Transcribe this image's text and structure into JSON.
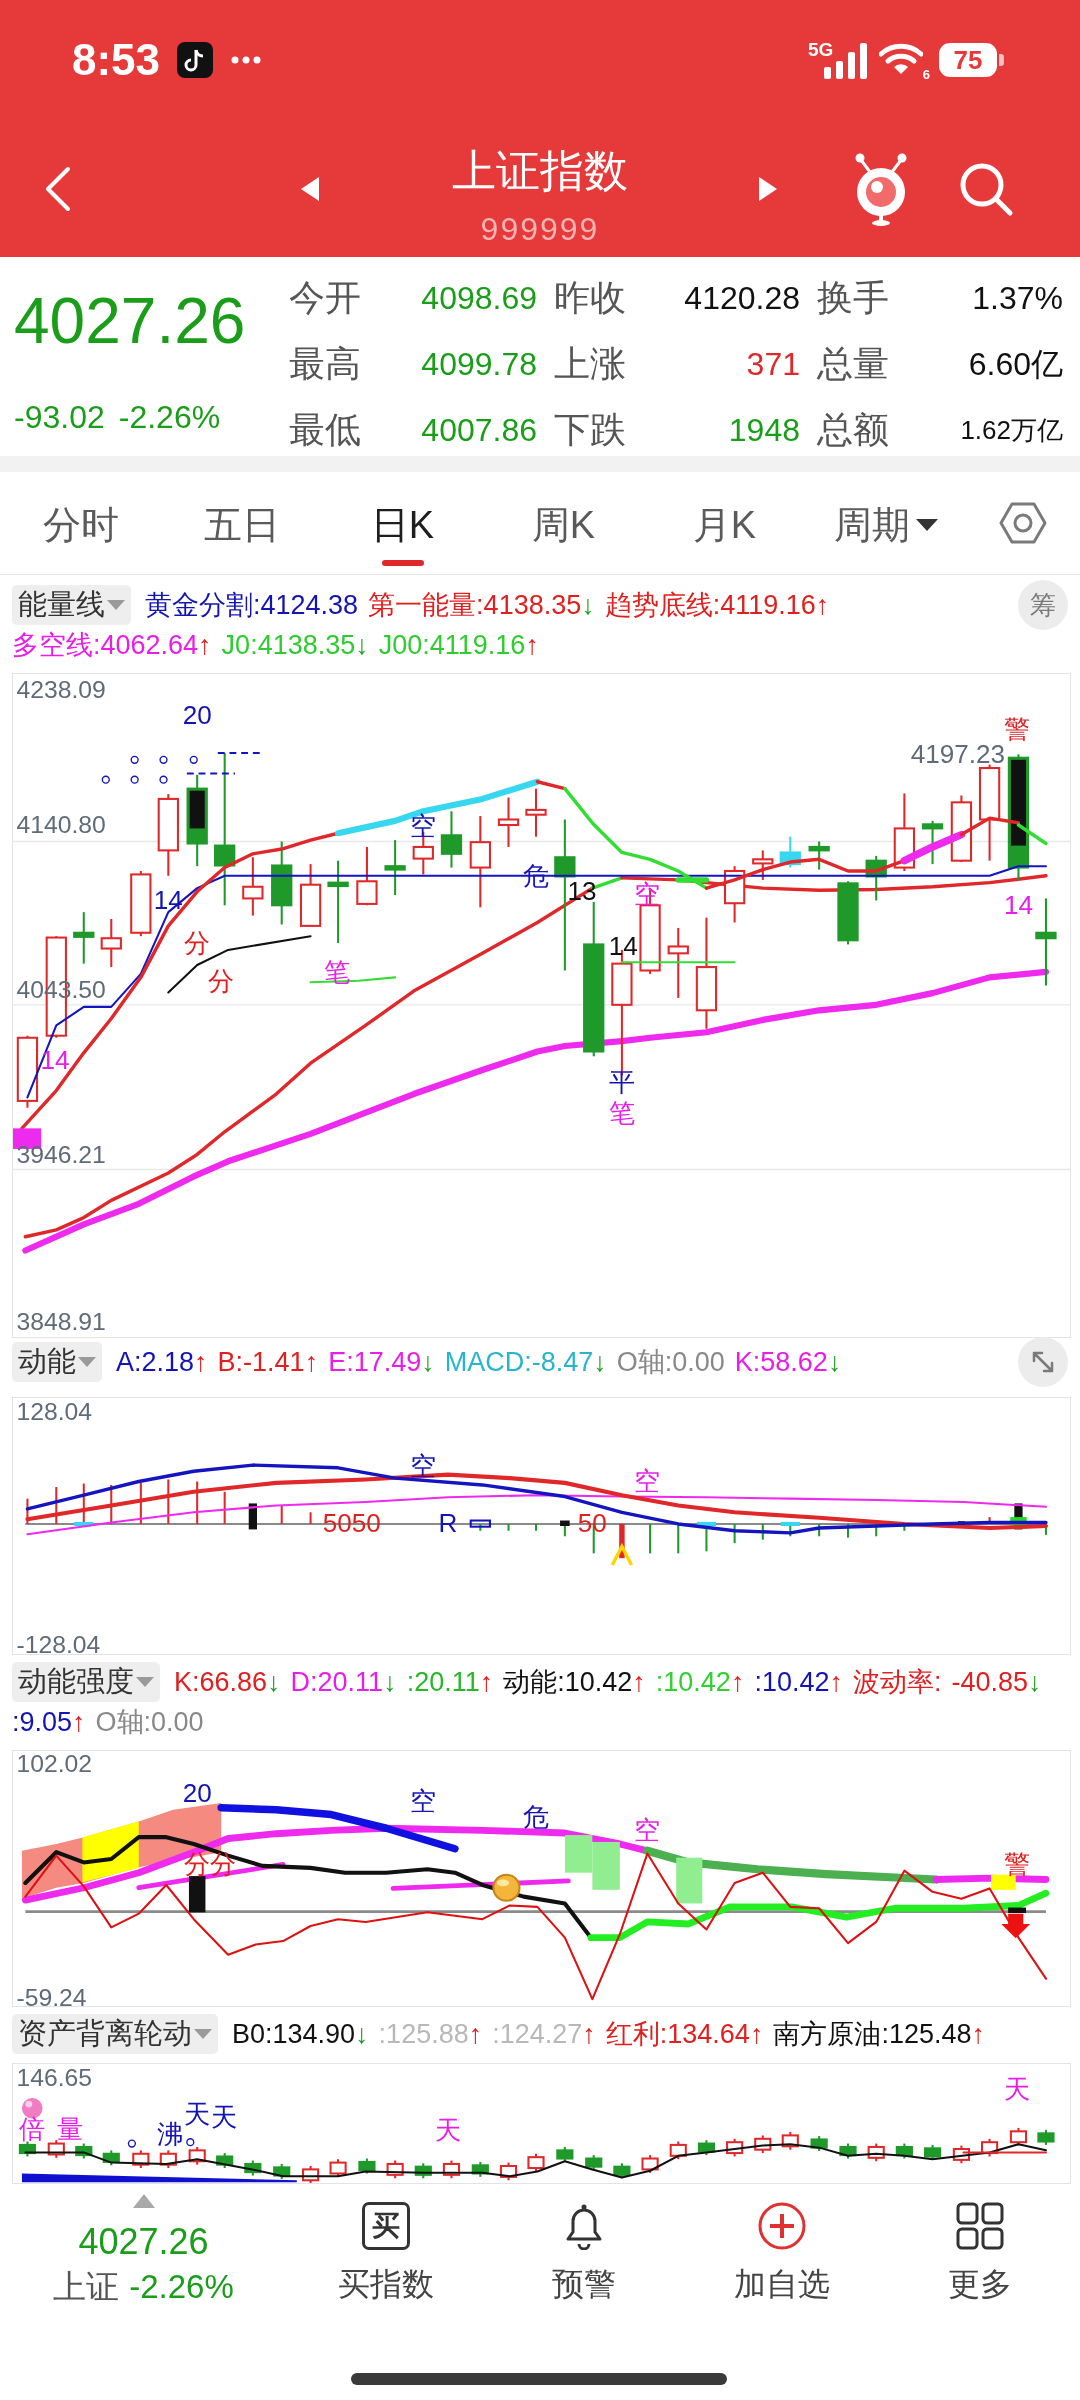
{
  "status_bar": {
    "time": "8:53",
    "network": "5G",
    "wifi_badge": "6",
    "battery": "75"
  },
  "header": {
    "title": "上证指数",
    "code": "999999"
  },
  "quote": {
    "price": "4027.26",
    "change": "-93.02",
    "change_percent": "-2.26%",
    "fields": [
      {
        "label": "今开",
        "value": "4098.69",
        "color": "#1a9e1a",
        "kind": "normal"
      },
      {
        "label": "昨收",
        "value": "4120.28",
        "color": "#111111",
        "kind": "normal"
      },
      {
        "label": "换手",
        "value": "1.37%",
        "color": "#111111",
        "kind": "normal"
      },
      {
        "label": "最高",
        "value": "4099.78",
        "color": "#1a9e1a",
        "kind": "normal"
      },
      {
        "label": "上涨",
        "value": "371",
        "color": "#e0282a",
        "kind": "normal"
      },
      {
        "label": "总量",
        "value": "6.60亿",
        "color": "#111111",
        "kind": "normal"
      },
      {
        "label": "最低",
        "value": "4007.86",
        "color": "#1a9e1a",
        "kind": "normal"
      },
      {
        "label": "下跌",
        "value": "1948",
        "color": "#1a9e1a",
        "kind": "normal"
      },
      {
        "label": "总额",
        "value": "1.62万亿",
        "color": "#111111",
        "kind": "compact"
      }
    ]
  },
  "tabs": [
    {
      "label": "分时",
      "selected": false,
      "kind": "tab"
    },
    {
      "label": "五日",
      "selected": false,
      "kind": "tab"
    },
    {
      "label": "日K",
      "selected": true,
      "kind": "tab"
    },
    {
      "label": "周K",
      "selected": false,
      "kind": "tab"
    },
    {
      "label": "月K",
      "selected": false,
      "kind": "tab"
    },
    {
      "label": "周期",
      "selected": false,
      "kind": "dropdown"
    }
  ],
  "panels": [
    {
      "kind": "energy",
      "indicator": "能量线",
      "side_button": "筹",
      "legend": [
        {
          "text": "黄金分割:4124.38",
          "color": "#1414b4"
        },
        {
          "text": "第一能量:4138.35",
          "color": "#e0201f",
          "arrow": {
            "text": "↓",
            "color": "#22a022"
          }
        },
        {
          "text": "趋势底线:4119.16",
          "color": "#e0201f",
          "arrow": {
            "text": "↑",
            "color": "#e0201f"
          }
        },
        {
          "text": "多空线:4062.64",
          "color": "#e81ee8",
          "arrow": {
            "text": "↑",
            "color": "#e0201f"
          }
        },
        {
          "text": "J0:4138.35",
          "color": "#2ecc2e",
          "arrow": {
            "text": "↓",
            "color": "#22a022"
          }
        },
        {
          "text": "J00:4119.16",
          "color": "#2ecc2e",
          "arrow": {
            "text": "↑",
            "color": "#e0201f"
          }
        }
      ],
      "y_axis_labels": [
        "4238.09",
        "4140.80",
        "4043.50",
        "3946.21",
        "3848.91"
      ],
      "annotations": [
        {
          "text": "20",
          "color": "#1414b4"
        },
        {
          "text": "14",
          "color": "#1414b4"
        },
        {
          "text": "14",
          "color": "#e81ee8"
        },
        {
          "text": "分",
          "color": "#e0201f"
        },
        {
          "text": "分",
          "color": "#e0201f"
        },
        {
          "text": "笔",
          "color": "#e81ee8"
        },
        {
          "text": "空",
          "color": "#1414b4"
        },
        {
          "text": "危",
          "color": "#1414b4"
        },
        {
          "text": "13",
          "color": "#111111"
        },
        {
          "text": "14",
          "color": "#111111"
        },
        {
          "text": "空",
          "color": "#e81ee8"
        },
        {
          "text": "平",
          "color": "#1414b4"
        },
        {
          "text": "笔",
          "color": "#e81ee8"
        },
        {
          "text": "4197.23",
          "color": "#5f6b78"
        },
        {
          "text": "警",
          "color": "#d8262a"
        },
        {
          "text": "14",
          "color": "#e81ee8"
        }
      ]
    },
    {
      "kind": "macd",
      "indicator": "动能",
      "legend": [
        {
          "text": "A:2.18",
          "color": "#1414b4",
          "arrow": {
            "text": "↑",
            "color": "#e0201f"
          }
        },
        {
          "text": "B:-1.41",
          "color": "#e0201f",
          "arrow": {
            "text": "↑",
            "color": "#e0201f"
          }
        },
        {
          "text": "E:17.49",
          "color": "#e81ee8",
          "arrow": {
            "text": "↓",
            "color": "#22a022"
          }
        },
        {
          "text": "MACD:-8.47",
          "color": "#26b5cc",
          "arrow": {
            "text": "↓",
            "color": "#22a022"
          }
        },
        {
          "text": "O轴:0.00",
          "color": "#888888"
        },
        {
          "text": "K:58.62",
          "color": "#e81ee8",
          "arrow": {
            "text": "↓",
            "color": "#22a022"
          }
        }
      ],
      "y_axis_labels": [
        "128.04",
        "-128.04"
      ],
      "annotations": [
        {
          "text": "空",
          "color": "#1414b4"
        },
        {
          "text": "空",
          "color": "#e81ee8"
        },
        {
          "text": "5050",
          "color": "#e0201f"
        },
        {
          "text": "R",
          "color": "#1414b4"
        },
        {
          "text": "50",
          "color": "#e0201f"
        }
      ]
    },
    {
      "kind": "strength",
      "indicator": "动能强度",
      "legend": [
        {
          "text": "K:66.86",
          "color": "#e0201f",
          "arrow": {
            "text": "↓",
            "color": "#22a022"
          }
        },
        {
          "text": "D:20.11",
          "color": "#e81ee8",
          "arrow": {
            "text": "↓",
            "color": "#22a022"
          }
        },
        {
          "text": ":20.11",
          "color": "#27b827",
          "arrow": {
            "text": "↑",
            "color": "#e0201f"
          }
        },
        {
          "text": "动能:10.42",
          "color": "#111111",
          "arrow": {
            "text": "↑",
            "color": "#e0201f"
          }
        },
        {
          "text": ":10.42",
          "color": "#2ed12e",
          "arrow": {
            "text": "↑",
            "color": "#e0201f"
          }
        },
        {
          "text": ":10.42",
          "color": "#1414b4",
          "arrow": {
            "text": "↑",
            "color": "#e0201f"
          }
        },
        {
          "text": "波动率:",
          "color": "#e0201f"
        },
        {
          "text": "-40.85",
          "color": "#e0201f",
          "arrow": {
            "text": "↓",
            "color": "#22a022"
          }
        },
        {
          "text": ":9.05",
          "color": "#1414b4",
          "arrow": {
            "text": "↑",
            "color": "#e0201f"
          }
        },
        {
          "text": "O轴:0.00",
          "color": "#888888"
        }
      ],
      "y_axis_labels": [
        "102.02",
        "-59.24"
      ],
      "annotations": [
        {
          "text": "20",
          "color": "#1414b4"
        },
        {
          "text": "空",
          "color": "#1414b4"
        },
        {
          "text": "危",
          "color": "#1414b4"
        },
        {
          "text": "空",
          "color": "#e81ee8"
        },
        {
          "text": "分",
          "color": "#e0201f"
        },
        {
          "text": "分",
          "color": "#e0201f"
        },
        {
          "text": "警",
          "color": "#e0201f"
        }
      ]
    },
    {
      "kind": "rotation",
      "indicator": "资产背离轮动",
      "legend": [
        {
          "text": "B0:134.90",
          "color": "#111111",
          "arrow": {
            "text": "↓",
            "color": "#22a022"
          }
        },
        {
          "text": ":125.88",
          "color": "#b8b8b8",
          "arrow": {
            "text": "↑",
            "color": "#e0201f"
          }
        },
        {
          "text": ":124.27",
          "color": "#b8b8b8",
          "arrow": {
            "text": "↑",
            "color": "#e0201f"
          }
        },
        {
          "text": "红利:134.64",
          "color": "#e0201f",
          "arrow": {
            "text": "↑",
            "color": "#e0201f"
          }
        },
        {
          "text": "南方原油:125.48",
          "color": "#111111",
          "arrow": {
            "text": "↑",
            "color": "#e0201f"
          }
        }
      ],
      "y_axis_labels": [
        "146.65"
      ],
      "annotations": [
        {
          "text": "倍",
          "color": "#e81ee8"
        },
        {
          "text": "量",
          "color": "#e81ee8"
        },
        {
          "text": "沸",
          "color": "#1414b4"
        },
        {
          "text": "天",
          "color": "#1414b4"
        },
        {
          "text": "天",
          "color": "#1414b4"
        },
        {
          "text": "天",
          "color": "#e81ee8"
        },
        {
          "text": "天",
          "color": "#e81ee8"
        }
      ]
    }
  ],
  "nav": {
    "price": "4027.26",
    "index_name": "上证",
    "change_percent": "-2.26%",
    "items": [
      {
        "label": "买指数",
        "kind": "buy",
        "icon_text": "买"
      },
      {
        "label": "预警",
        "kind": "alert"
      },
      {
        "label": "加自选",
        "kind": "add"
      },
      {
        "label": "更多",
        "kind": "more"
      }
    ]
  }
}
